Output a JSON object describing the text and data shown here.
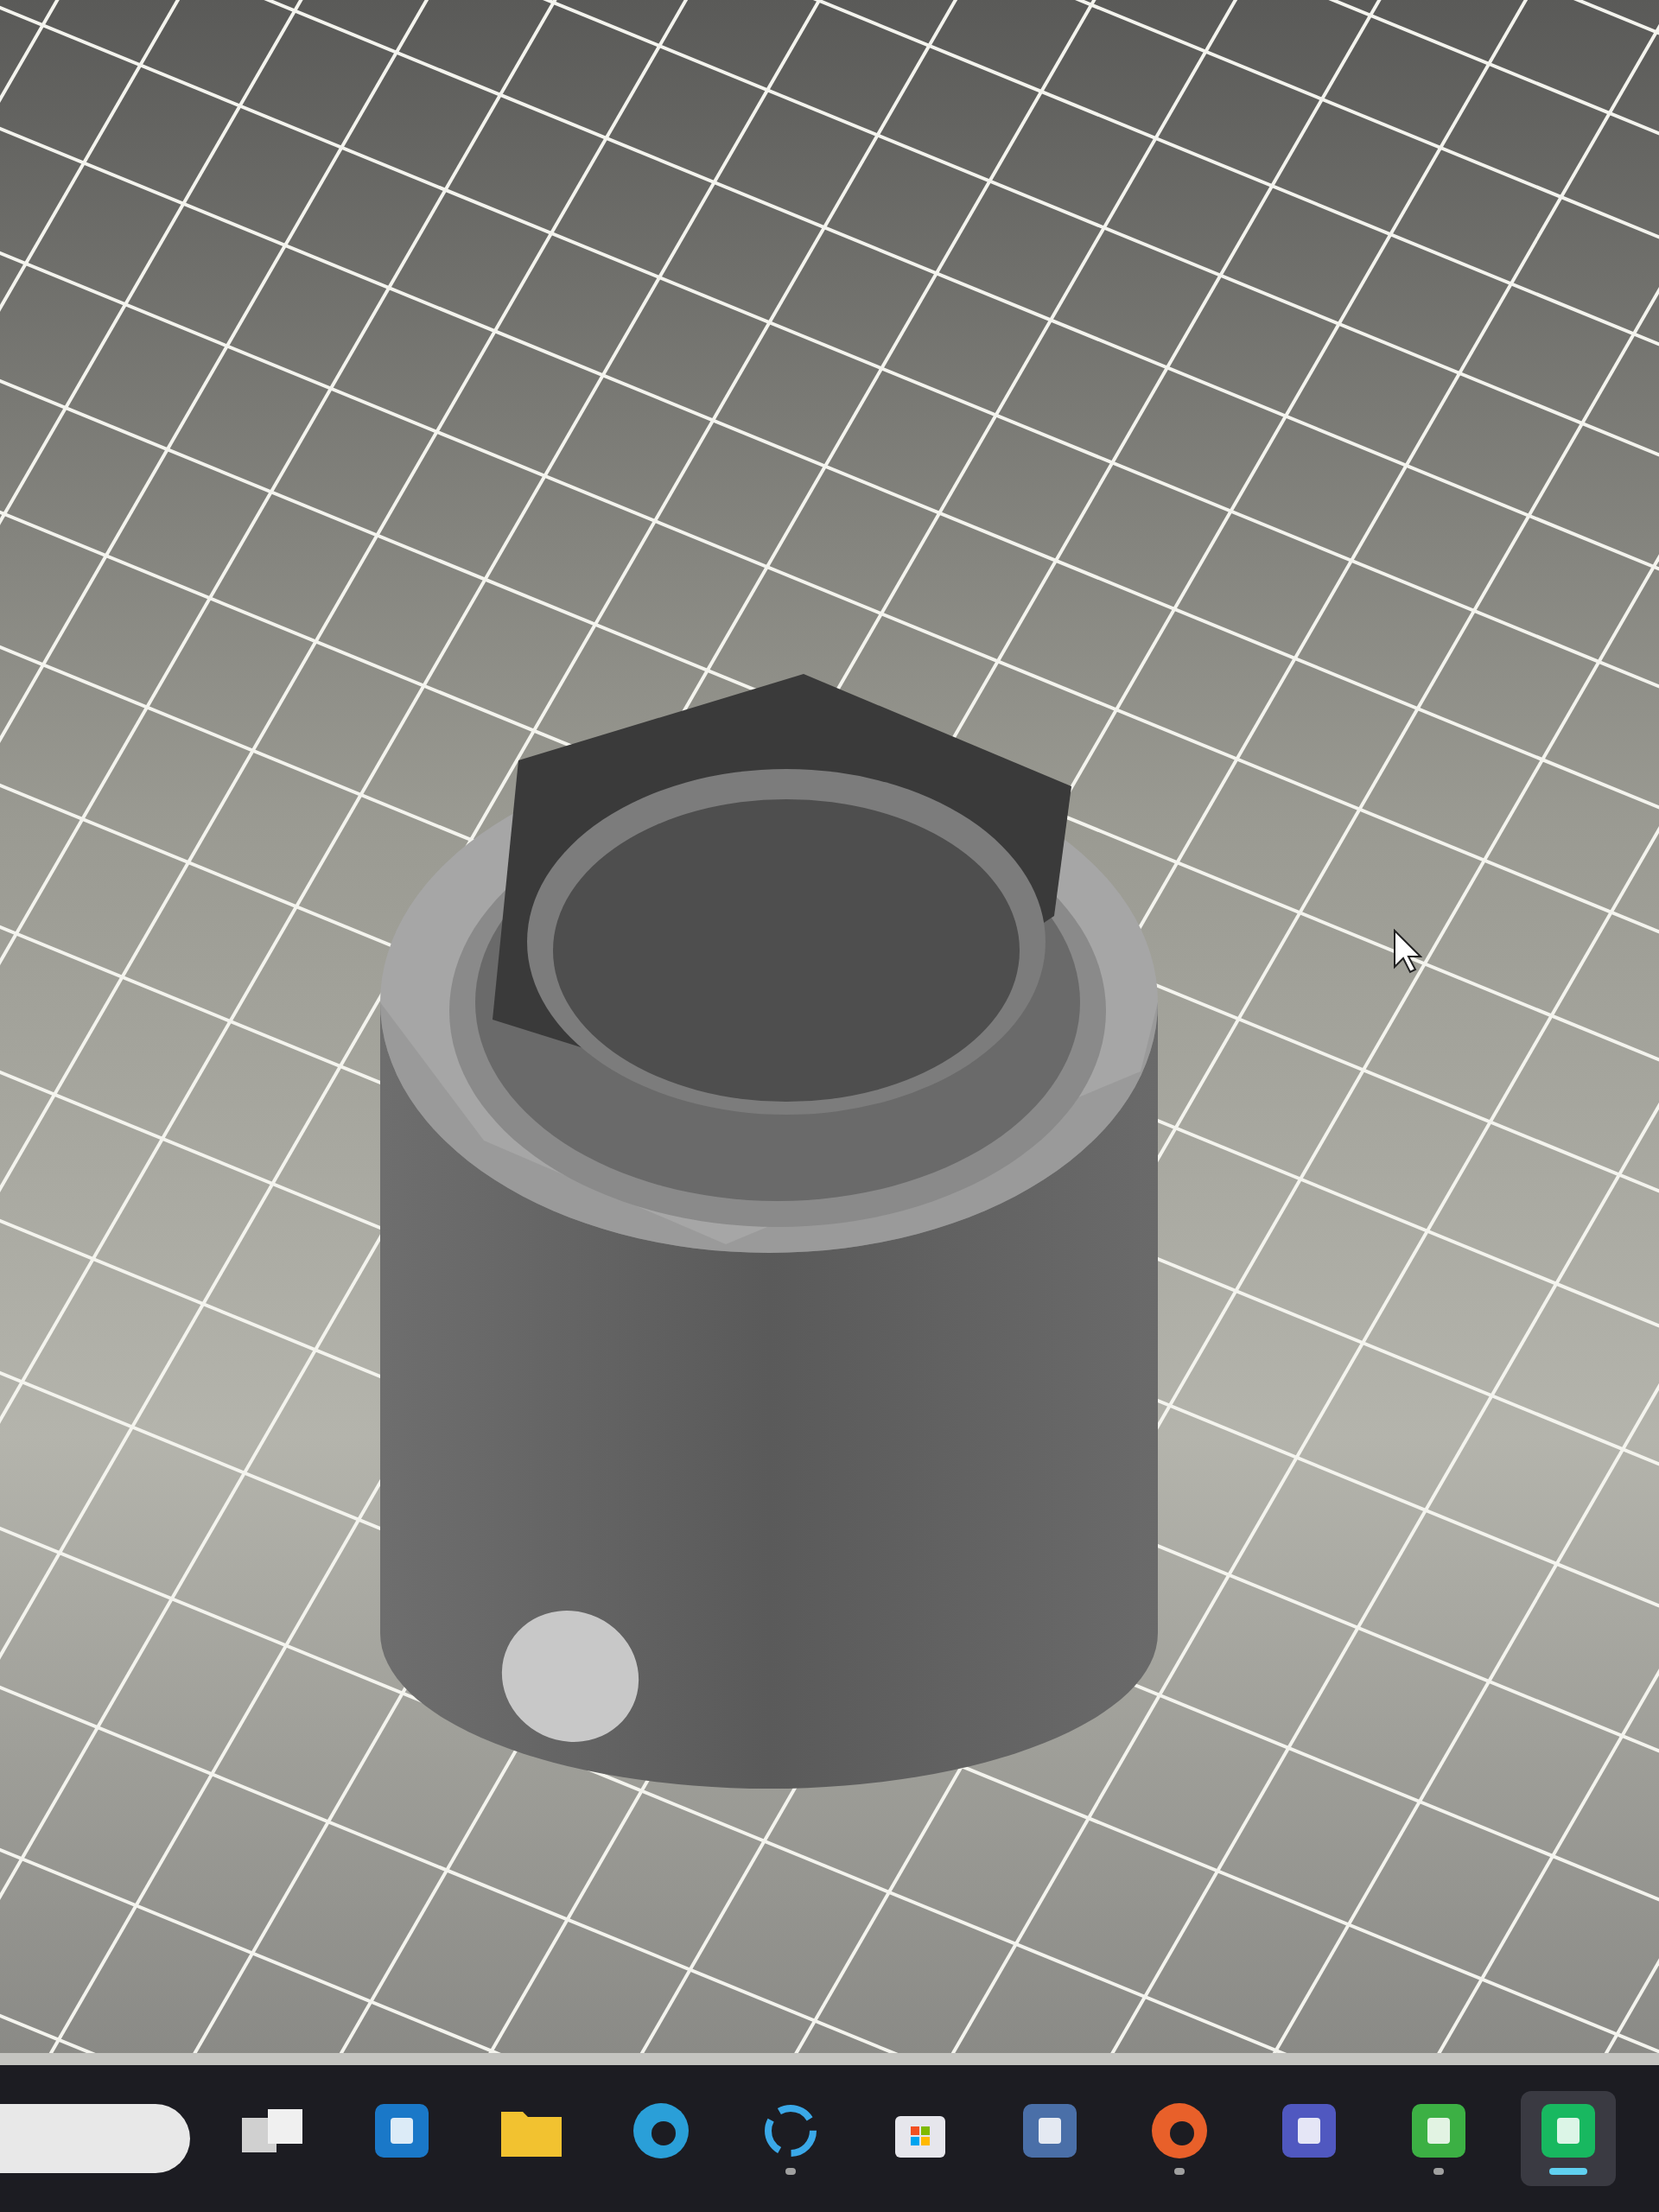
{
  "viewport": {
    "kind": "cad"
  },
  "taskbar": {
    "items": [
      {
        "kind": "search",
        "color": "#e8e8e8"
      },
      {
        "kind": "taskview",
        "running": false,
        "selected": false,
        "color": "#d0d0d0"
      },
      {
        "kind": "app",
        "running": false,
        "selected": false,
        "color": "#1a78c8"
      },
      {
        "kind": "folder",
        "running": false,
        "selected": false,
        "color": "#f2c230"
      },
      {
        "kind": "round",
        "running": false,
        "selected": false,
        "color": "#2a9fd8"
      },
      {
        "kind": "ring",
        "running": true,
        "selected": false,
        "color": "#3aa8e8"
      },
      {
        "kind": "bag",
        "running": false,
        "selected": false,
        "color": "#e6e6ec"
      },
      {
        "kind": "app",
        "running": false,
        "selected": false,
        "color": "#4a6fa8"
      },
      {
        "kind": "round",
        "running": true,
        "selected": false,
        "color": "#e8602a"
      },
      {
        "kind": "app",
        "running": false,
        "selected": false,
        "color": "#5058c0"
      },
      {
        "kind": "app",
        "running": true,
        "selected": false,
        "color": "#3cb044"
      },
      {
        "kind": "app",
        "running": true,
        "selected": true,
        "color": "#18b860"
      }
    ]
  }
}
